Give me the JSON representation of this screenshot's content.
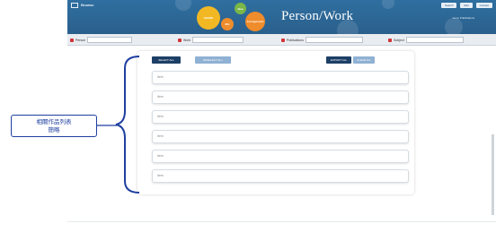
{
  "header": {
    "brand": "Browse",
    "title": "Person/Work",
    "links": [
      "Search",
      "Edit",
      "Contact"
    ],
    "goto": "Go to Publications",
    "bubbles": {
      "share": "SHARE",
      "idea": "Idea",
      "mix": "Mix",
      "arrangement": "Arrangement"
    }
  },
  "filters": [
    {
      "label": "Person",
      "value": "",
      "color": "#d0343a"
    },
    {
      "label": "Work",
      "value": "",
      "color": "#d0343a"
    },
    {
      "label": "Publications",
      "value": "",
      "color": "#d0343a"
    },
    {
      "label": "Subject",
      "value": "",
      "color": "#d0343a"
    }
  ],
  "toolbar": {
    "select_all": "SELECT ALL",
    "deselect_all": "DESELECT ALL",
    "export_all": "EXPORT ALL",
    "clear_all": "CLEAR ALL"
  },
  "items": [
    "Item",
    "Item",
    "Item",
    "Item",
    "Item",
    "Item"
  ],
  "annotation": {
    "line1": "相關作品列表",
    "line2": "簡略"
  },
  "colors": {
    "header_bg": "#2f6fa0",
    "button_dark": "#1d3f66",
    "button_light": "#8fb1d3",
    "annotation": "#1f3f9f"
  }
}
